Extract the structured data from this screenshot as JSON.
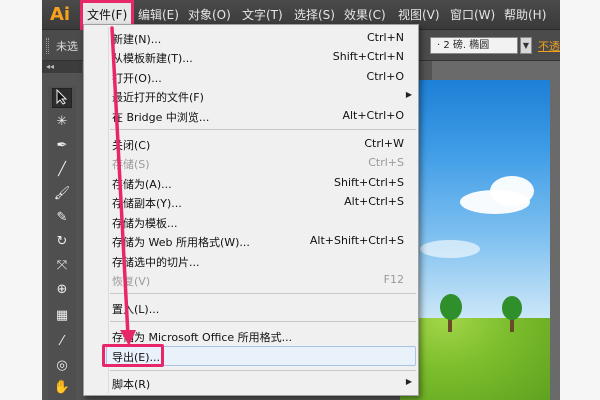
{
  "app": {
    "logo": "Ai",
    "menu": [
      {
        "id": "file",
        "label": "文件(F)"
      },
      {
        "id": "edit",
        "label": "编辑(E)"
      },
      {
        "id": "object",
        "label": "对象(O)"
      },
      {
        "id": "text",
        "label": "文字(T)"
      },
      {
        "id": "select",
        "label": "选择(S)"
      },
      {
        "id": "effect",
        "label": "效果(C)"
      },
      {
        "id": "view",
        "label": "视图(V)"
      },
      {
        "id": "window",
        "label": "窗口(W)"
      },
      {
        "id": "help",
        "label": "帮助(H)"
      }
    ]
  },
  "controlbar": {
    "selection_text": "未选",
    "brush_value": "· 2 磅. 椭圆",
    "opacity_link": "不透"
  },
  "tools_panel": {
    "header": "◂◂",
    "tools": [
      "selection-tool",
      "magic-wand-tool",
      "pen-tool",
      "line-tool",
      "paintbrush-tool",
      "blob-brush-tool",
      "rotate-tool",
      "width-tool",
      "shape-builder-tool",
      "perspective-grid-tool",
      "eyedropper-tool",
      "symbol-sprayer-tool",
      "hand-tool"
    ]
  },
  "file_menu": {
    "items": [
      {
        "label": "新建(N)...",
        "shortcut": "Ctrl+N"
      },
      {
        "label": "从模板新建(T)...",
        "shortcut": "Shift+Ctrl+N"
      },
      {
        "label": "打开(O)...",
        "shortcut": "Ctrl+O"
      },
      {
        "label": "最近打开的文件(F)",
        "shortcut": "",
        "submenu": true
      },
      {
        "label": "在 Bridge 中浏览...",
        "shortcut": "Alt+Ctrl+O"
      },
      {
        "separator": true
      },
      {
        "label": "关闭(C)",
        "shortcut": "Ctrl+W"
      },
      {
        "label": "存储(S)",
        "shortcut": "Ctrl+S",
        "disabled": true
      },
      {
        "label": "存储为(A)...",
        "shortcut": "Shift+Ctrl+S"
      },
      {
        "label": "存储副本(Y)...",
        "shortcut": "Alt+Ctrl+S"
      },
      {
        "label": "存储为模板...",
        "shortcut": ""
      },
      {
        "label": "存储为 Web 所用格式(W)...",
        "shortcut": "Alt+Shift+Ctrl+S"
      },
      {
        "label": "存储选中的切片...",
        "shortcut": ""
      },
      {
        "label": "恢复(V)",
        "shortcut": "F12",
        "disabled": true
      },
      {
        "separator": true
      },
      {
        "label": "置入(L)...",
        "shortcut": ""
      },
      {
        "separator": true
      },
      {
        "label": "存储为 Microsoft Office 所用格式...",
        "shortcut": ""
      },
      {
        "label": "导出(E)...",
        "shortcut": "",
        "highlighted": true
      },
      {
        "separator": true
      },
      {
        "label": "脚本(R)",
        "shortcut": "",
        "submenu": true
      }
    ],
    "submenu_arrow": "▶"
  },
  "annotation": {
    "color": "#e8276b"
  },
  "colors": {
    "accent": "#e8276b",
    "app_bg": "#535353",
    "menu_bg": "#f0f0f0",
    "logo": "#f7a21b"
  }
}
